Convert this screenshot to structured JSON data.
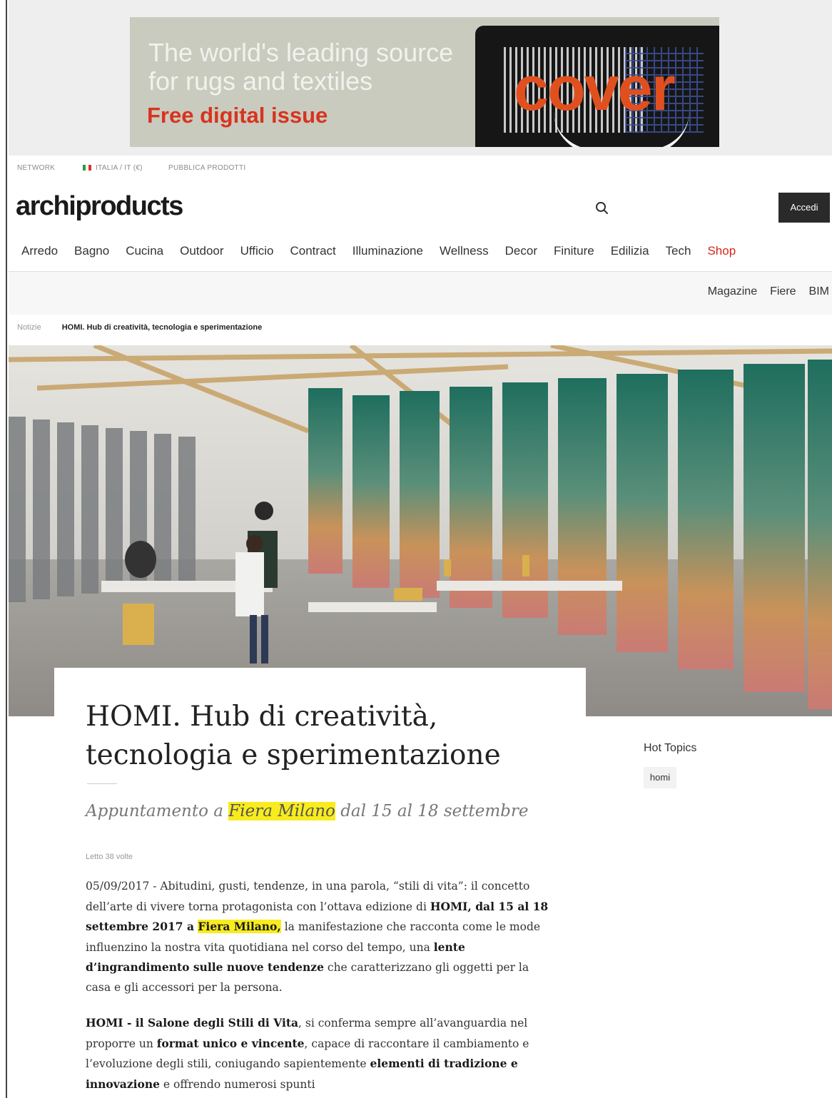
{
  "ad": {
    "headline_line1": "The world's leading source",
    "headline_line2": "for rugs and textiles",
    "cta": "Free digital issue",
    "logo_text": "cover",
    "accent_color": "#d8331f"
  },
  "utility_bar": {
    "network": "NETWORK",
    "country": "ITALIA / IT (€)",
    "publish": "PUBBLICA PRODOTTI"
  },
  "header": {
    "logo": "archiproducts",
    "search_icon": "search-icon",
    "login_label": "Accedi"
  },
  "main_nav": {
    "items": [
      "Arredo",
      "Bagno",
      "Cucina",
      "Outdoor",
      "Ufficio",
      "Contract",
      "Illuminazione",
      "Wellness",
      "Decor",
      "Finiture",
      "Edilizia",
      "Tech",
      "Shop"
    ],
    "shop_color": "#d4251c"
  },
  "sub_nav": {
    "items": [
      "Magazine",
      "Fiere",
      "BIM"
    ]
  },
  "breadcrumb": {
    "parent": "Notizie",
    "current": "HOMI. Hub di creatività, tecnologia e sperimentazione"
  },
  "article": {
    "title_line1": "HOMI. Hub di creatività,",
    "title_line2": "tecnologia e sperimentazione",
    "subtitle_pre": "Appuntamento a ",
    "subtitle_highlight": "Fiera Milano",
    "subtitle_post": " dal 15 al 18 settembre",
    "read_count": "Letto 38 volte",
    "highlight_color": "#f8ec1e",
    "p1": {
      "t1": "05/09/2017 - Abitudini, gusti, tendenze, in una parola, “stili di vita”: il concetto dell’arte di vivere torna protagonista con l’ottava edizione di ",
      "b1": "HOMI, dal 15 al 18 settembre 2017 a ",
      "hl": "Fiera Milano,",
      "t2": " la manifestazione che racconta come le mode influenzino la nostra vita quotidiana nel corso del tempo, una ",
      "b2": "lente d’ingrandimento sulle nuove tendenze",
      "t3": " che caratterizzano gli oggetti per la casa e gli accessori per la persona."
    },
    "p2": {
      "b1": "HOMI - il Salone degli Stili di Vita",
      "t1": ", si conferma sempre all’avanguardia nel proporre un ",
      "b2": "format unico e vincente",
      "t2": ", capace di raccontare il cambiamento e l’evoluzione degli stili, coniugando sapientemente ",
      "b3": "elementi di tradizione e innovazione",
      "t3": " e offrendo numerosi spunti"
    }
  },
  "sidebar": {
    "hot_topics_title": "Hot Topics",
    "tags": [
      "homi"
    ]
  }
}
